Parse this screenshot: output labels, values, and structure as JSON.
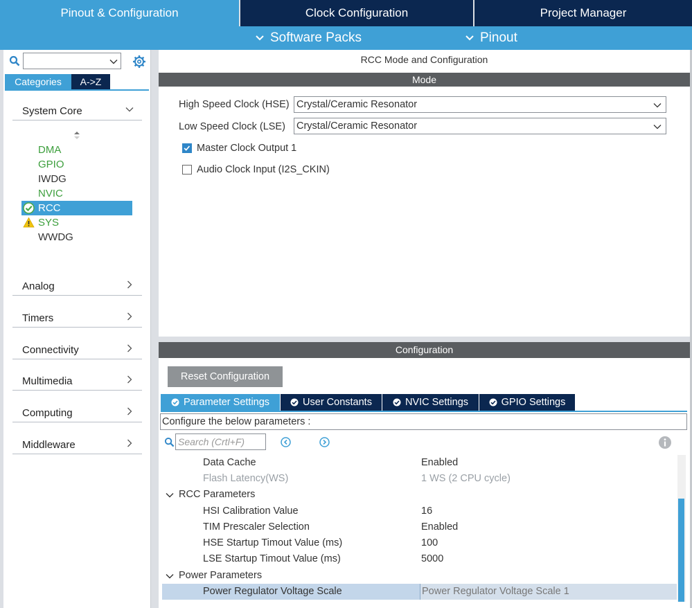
{
  "top_tabs": [
    "Pinout & Configuration",
    "Clock Configuration",
    "Project Manager"
  ],
  "sub_menu": [
    "Software Packs",
    "Pinout"
  ],
  "left": {
    "category_tabs": [
      "Categories",
      "A->Z"
    ],
    "groups": [
      {
        "label": "System Core",
        "expanded": true
      },
      {
        "label": "Analog"
      },
      {
        "label": "Timers"
      },
      {
        "label": "Connectivity"
      },
      {
        "label": "Multimedia"
      },
      {
        "label": "Computing"
      },
      {
        "label": "Middleware"
      }
    ],
    "system_core_items": [
      {
        "label": "DMA",
        "status": "green"
      },
      {
        "label": "GPIO",
        "status": "green"
      },
      {
        "label": "IWDG",
        "status": "plain"
      },
      {
        "label": "NVIC",
        "status": "green"
      },
      {
        "label": "RCC",
        "status": "selected-ok"
      },
      {
        "label": "SYS",
        "status": "warning"
      },
      {
        "label": "WWDG",
        "status": "plain"
      }
    ]
  },
  "mode": {
    "title": "RCC Mode and Configuration",
    "section": "Mode",
    "hse_label": "High Speed Clock (HSE)",
    "hse_value": "Crystal/Ceramic Resonator",
    "lse_label": "Low Speed Clock (LSE)",
    "lse_value": "Crystal/Ceramic Resonator",
    "mco_label": "Master Clock Output 1",
    "mco_checked": true,
    "i2s_label": "Audio Clock Input (I2S_CKIN)",
    "i2s_checked": false
  },
  "config": {
    "section": "Configuration",
    "reset_label": "Reset Configuration",
    "tabs": [
      "Parameter Settings",
      "User Constants",
      "NVIC Settings",
      "GPIO Settings"
    ],
    "hint": "Configure the below parameters :",
    "search_placeholder": "Search (Crtl+F)",
    "rows": [
      {
        "type": "param",
        "name": "Data Cache",
        "value": "Enabled"
      },
      {
        "type": "param",
        "name": "Flash Latency(WS)",
        "value": "1 WS (2 CPU cycle)",
        "disabled": true
      },
      {
        "type": "group",
        "name": "RCC Parameters"
      },
      {
        "type": "param",
        "name": "HSI Calibration Value",
        "value": "16"
      },
      {
        "type": "param",
        "name": "TIM Prescaler Selection",
        "value": "Enabled"
      },
      {
        "type": "param",
        "name": "HSE Startup Timout Value (ms)",
        "value": "100"
      },
      {
        "type": "param",
        "name": "LSE Startup Timout Value (ms)",
        "value": "5000"
      },
      {
        "type": "group",
        "name": "Power Parameters"
      },
      {
        "type": "param",
        "name": "Power Regulator Voltage Scale",
        "value": "Power Regulator Voltage Scale 1",
        "selected": true
      }
    ]
  },
  "colors": {
    "navy": "#0b2750",
    "accent": "#3fa0d6",
    "section_bar": "#5a5d60",
    "green_text": "#3d9f3d"
  }
}
